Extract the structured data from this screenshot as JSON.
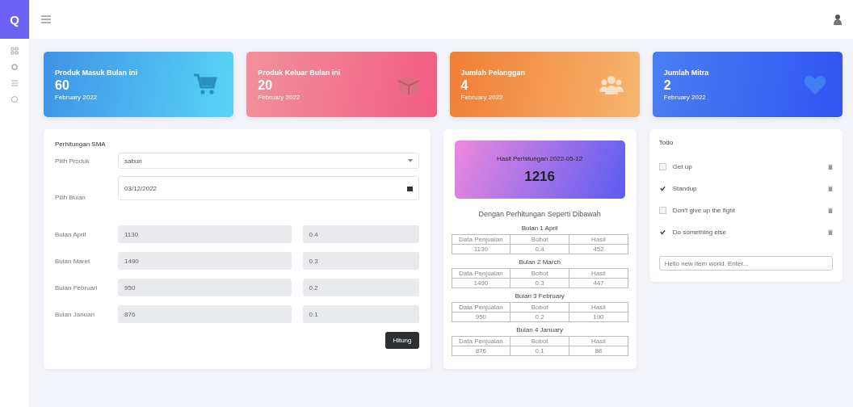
{
  "sidebar": {
    "logo": "Q"
  },
  "stats": [
    {
      "kind": "cart",
      "title": "Produk Masuk Bulan ini",
      "value": "60",
      "period": "February 2022"
    },
    {
      "kind": "box",
      "title": "Produk Keluar Bulan ini",
      "value": "20",
      "period": "February 2022"
    },
    {
      "kind": "people",
      "title": "Jumlah Pelanggan",
      "value": "4",
      "period": "February 2022"
    },
    {
      "kind": "heart",
      "title": "Jumlah Mitra",
      "value": "2",
      "period": "February 2022"
    }
  ],
  "form": {
    "title": "Perhitungan SMA",
    "product_label": "Pilih Produk",
    "product_value": "sabun",
    "month_label": "Pilih Bulan",
    "month_value": "03/12/2022",
    "rows": [
      {
        "label": "Bulan April",
        "sales": "1130",
        "weight": "0.4"
      },
      {
        "label": "Bulan Maret",
        "sales": "1490",
        "weight": "0.3"
      },
      {
        "label": "Bulan Februari",
        "sales": "950",
        "weight": "0.2"
      },
      {
        "label": "Bulan Januari",
        "sales": "876",
        "weight": "0.1"
      }
    ],
    "button": "Hitung"
  },
  "result": {
    "title": "Hasil Perhitungan 2022-05-12",
    "value": "1216",
    "subtitle": "Dengan Perhitungan Seperti Dibawah",
    "months": [
      {
        "title": "Bulan 1 April",
        "columns": [
          "Data Penjualan",
          "Bobot",
          "Hasil"
        ],
        "cells": [
          "1130",
          "0.4",
          "452"
        ]
      },
      {
        "title": "Bulan 2 March",
        "columns": [
          "Data Penjualan",
          "Bobot",
          "Hasil"
        ],
        "cells": [
          "1490",
          "0.3",
          "447"
        ]
      },
      {
        "title": "Bulan 3 February",
        "columns": [
          "Data Penjualan",
          "Bobot",
          "Hasil"
        ],
        "cells": [
          "950",
          "0.2",
          "190"
        ]
      },
      {
        "title": "Bulan 4 January",
        "columns": [
          "Data Penjualan",
          "Bobot",
          "Hasil"
        ],
        "cells": [
          "876",
          "0.1",
          "88"
        ]
      }
    ]
  },
  "todo": {
    "title": "Todo",
    "items": [
      {
        "text": "Get up",
        "checked": false
      },
      {
        "text": "Standup",
        "checked": true
      },
      {
        "text": "Don't give up the fight",
        "checked": false
      },
      {
        "text": "Do something else",
        "checked": true
      }
    ],
    "placeholder": "Hello new item world. Enter..."
  }
}
